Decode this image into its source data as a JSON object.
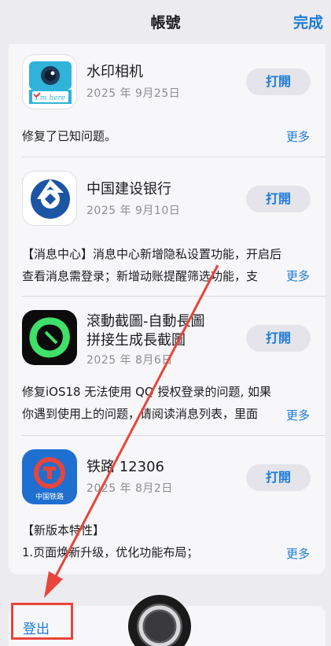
{
  "header": {
    "title": "帳號",
    "done_label": "完成"
  },
  "apps": [
    {
      "name": "水印相机",
      "date": "2025 年 9月25日",
      "open_label": "打開",
      "notes": [
        "修复了已知问题。"
      ],
      "more_label": "更多",
      "icon": "camera-icon",
      "icon_text": "I'm here"
    },
    {
      "name": "中国建设银行",
      "date": "2025 年 9月10日",
      "open_label": "打開",
      "notes": [
        "【消息中心】消息中心新增隐私设置功能，开启后",
        "查看消息需登录；新增动账提醒筛选功能，支"
      ],
      "more_label": "更多",
      "icon": "ccb-bank-icon"
    },
    {
      "name_line1": "滾動截圖-自動長圖",
      "name_line2": "拼接生成長截圖",
      "date": "2025 年 8月6日",
      "open_label": "打開",
      "notes": [
        "修复iOS18 无法使用 QQ 授权登录的问题, 如果",
        "你遇到使用上的问题，请阅读消息列表，里面"
      ],
      "more_label": "更多",
      "icon": "scroll-screenshot-icon"
    },
    {
      "name": "铁路 12306",
      "date": "2025 年 8月2日",
      "open_label": "打開",
      "notes": [
        "【新版本特性】",
        "1.页面焕新升级，优化功能布局；"
      ],
      "more_label": "更多",
      "icon": "railway-icon",
      "icon_text": "中国铁路"
    }
  ],
  "footer": {
    "logout_label": "登出"
  },
  "colors": {
    "accent": "#1e7bd8",
    "annotation": "#e8453c"
  }
}
